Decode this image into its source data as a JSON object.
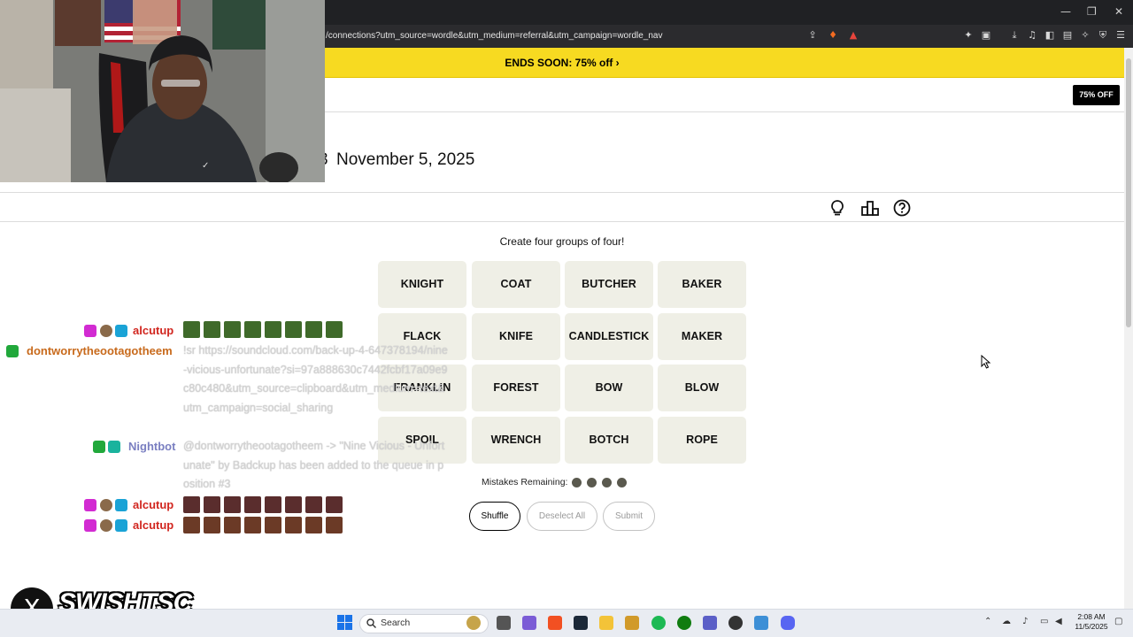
{
  "browser": {
    "url": "/connections?utm_source=wordle&utm_medium=referral&utm_campaign=wordle_nav",
    "window_controls": [
      "—",
      "❐",
      "✕"
    ]
  },
  "promo": {
    "text": "ENDS SOON:  75% off ›"
  },
  "navbar": {
    "offer_badge": "75% OFF"
  },
  "header": {
    "date_prefix": "3",
    "date": "November 5, 2025"
  },
  "toolbar": {
    "icons": [
      "lightbulb-icon",
      "leaderboard-icon",
      "help-icon"
    ]
  },
  "game": {
    "instructions": "Create four groups of four!",
    "tiles": [
      [
        "KNIGHT",
        "COAT",
        "BUTCHER",
        "BAKER"
      ],
      [
        "FLACK",
        "KNIFE",
        "CANDLESTICK",
        "MAKER"
      ],
      [
        "FRANKLIN",
        "FOREST",
        "BOW",
        "BLOW"
      ],
      [
        "SPOIL",
        "WRENCH",
        "BOTCH",
        "ROPE"
      ]
    ],
    "mistakes_label": "Mistakes Remaining:",
    "mistakes_remaining": 4,
    "buttons": {
      "shuffle": "Shuffle",
      "deselect": "Deselect All",
      "submit": "Submit"
    }
  },
  "chat": [
    {
      "user": "alcutup",
      "color": "#d1261f",
      "emote_count": 8,
      "emote_color": "#3f6a2a"
    },
    {
      "user": "dontworrytheootagotheem",
      "color": "#c86a1c",
      "message": "!sr https://soundcloud.com/back-up-4-647378194/nine-vicious-unfortunate?si=97a888630c7442fcbf17a09e9c80c480&utm_source=clipboard&utm_medium=text&utm_campaign=social_sharing"
    },
    {
      "user": "Nightbot",
      "color": "#7a7fc1",
      "message": "@dontworrytheootagotheem -> \"Nine Vicious - Unfortunate\" by Badckup has been added to the queue in position #3"
    },
    {
      "user": "alcutup",
      "color": "#d1261f",
      "emote_count": 8,
      "emote_color": "#5a2d2d"
    },
    {
      "user": "alcutup",
      "color": "#d1261f",
      "emote_count": 8,
      "emote_color": "#6b3a26"
    }
  ],
  "overlay": {
    "handle": "SWISHTSC",
    "x_logo": "X"
  },
  "taskbar": {
    "search_label": "Search",
    "time": "2:08 AM",
    "date": "11/5/2025"
  }
}
